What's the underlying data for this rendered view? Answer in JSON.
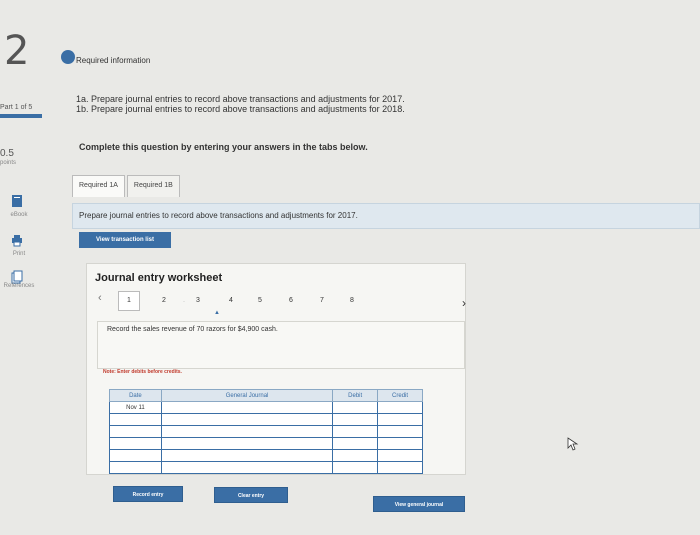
{
  "question": {
    "number": "2",
    "badge": "Required information",
    "part": "Part 1 of 5",
    "points": "0.5",
    "points_label": "points"
  },
  "rail": {
    "ebook": "eBook",
    "print": "Print",
    "references": "References"
  },
  "instructions": {
    "line1": "1a. Prepare journal entries to record above transactions and adjustments for 2017.",
    "line2": "1b. Prepare journal entries to record above transactions and adjustments for 2018.",
    "complete": "Complete this question by entering your answers in the tabs below."
  },
  "tabs": [
    {
      "label": "Required 1A"
    },
    {
      "label": "Required 1B"
    }
  ],
  "prompt": "Prepare journal entries to record above transactions and adjustments for 2017.",
  "view_transaction_list": "View transaction list",
  "worksheet": {
    "title": "Journal entry worksheet",
    "steps": [
      "1",
      "2",
      "3",
      "4",
      "5",
      "6",
      "7",
      "8"
    ],
    "dot": "·",
    "transaction": "Record the sales revenue of 70 razors for $4,900 cash.",
    "note": "Note: Enter debits before credits."
  },
  "journal": {
    "headers": {
      "date": "Date",
      "general_journal": "General Journal",
      "debit": "Debit",
      "credit": "Credit"
    },
    "rows": [
      {
        "date": "Nov 11"
      },
      {
        "date": ""
      },
      {
        "date": ""
      },
      {
        "date": ""
      },
      {
        "date": ""
      },
      {
        "date": ""
      }
    ]
  },
  "buttons": {
    "record": "Record entry",
    "clear": "Clear entry",
    "view_general_journal": "View general journal"
  },
  "icons": {
    "prev": "‹",
    "next": "›"
  },
  "colors": {
    "accent": "#3a6ea5",
    "note": "#c0392b"
  }
}
